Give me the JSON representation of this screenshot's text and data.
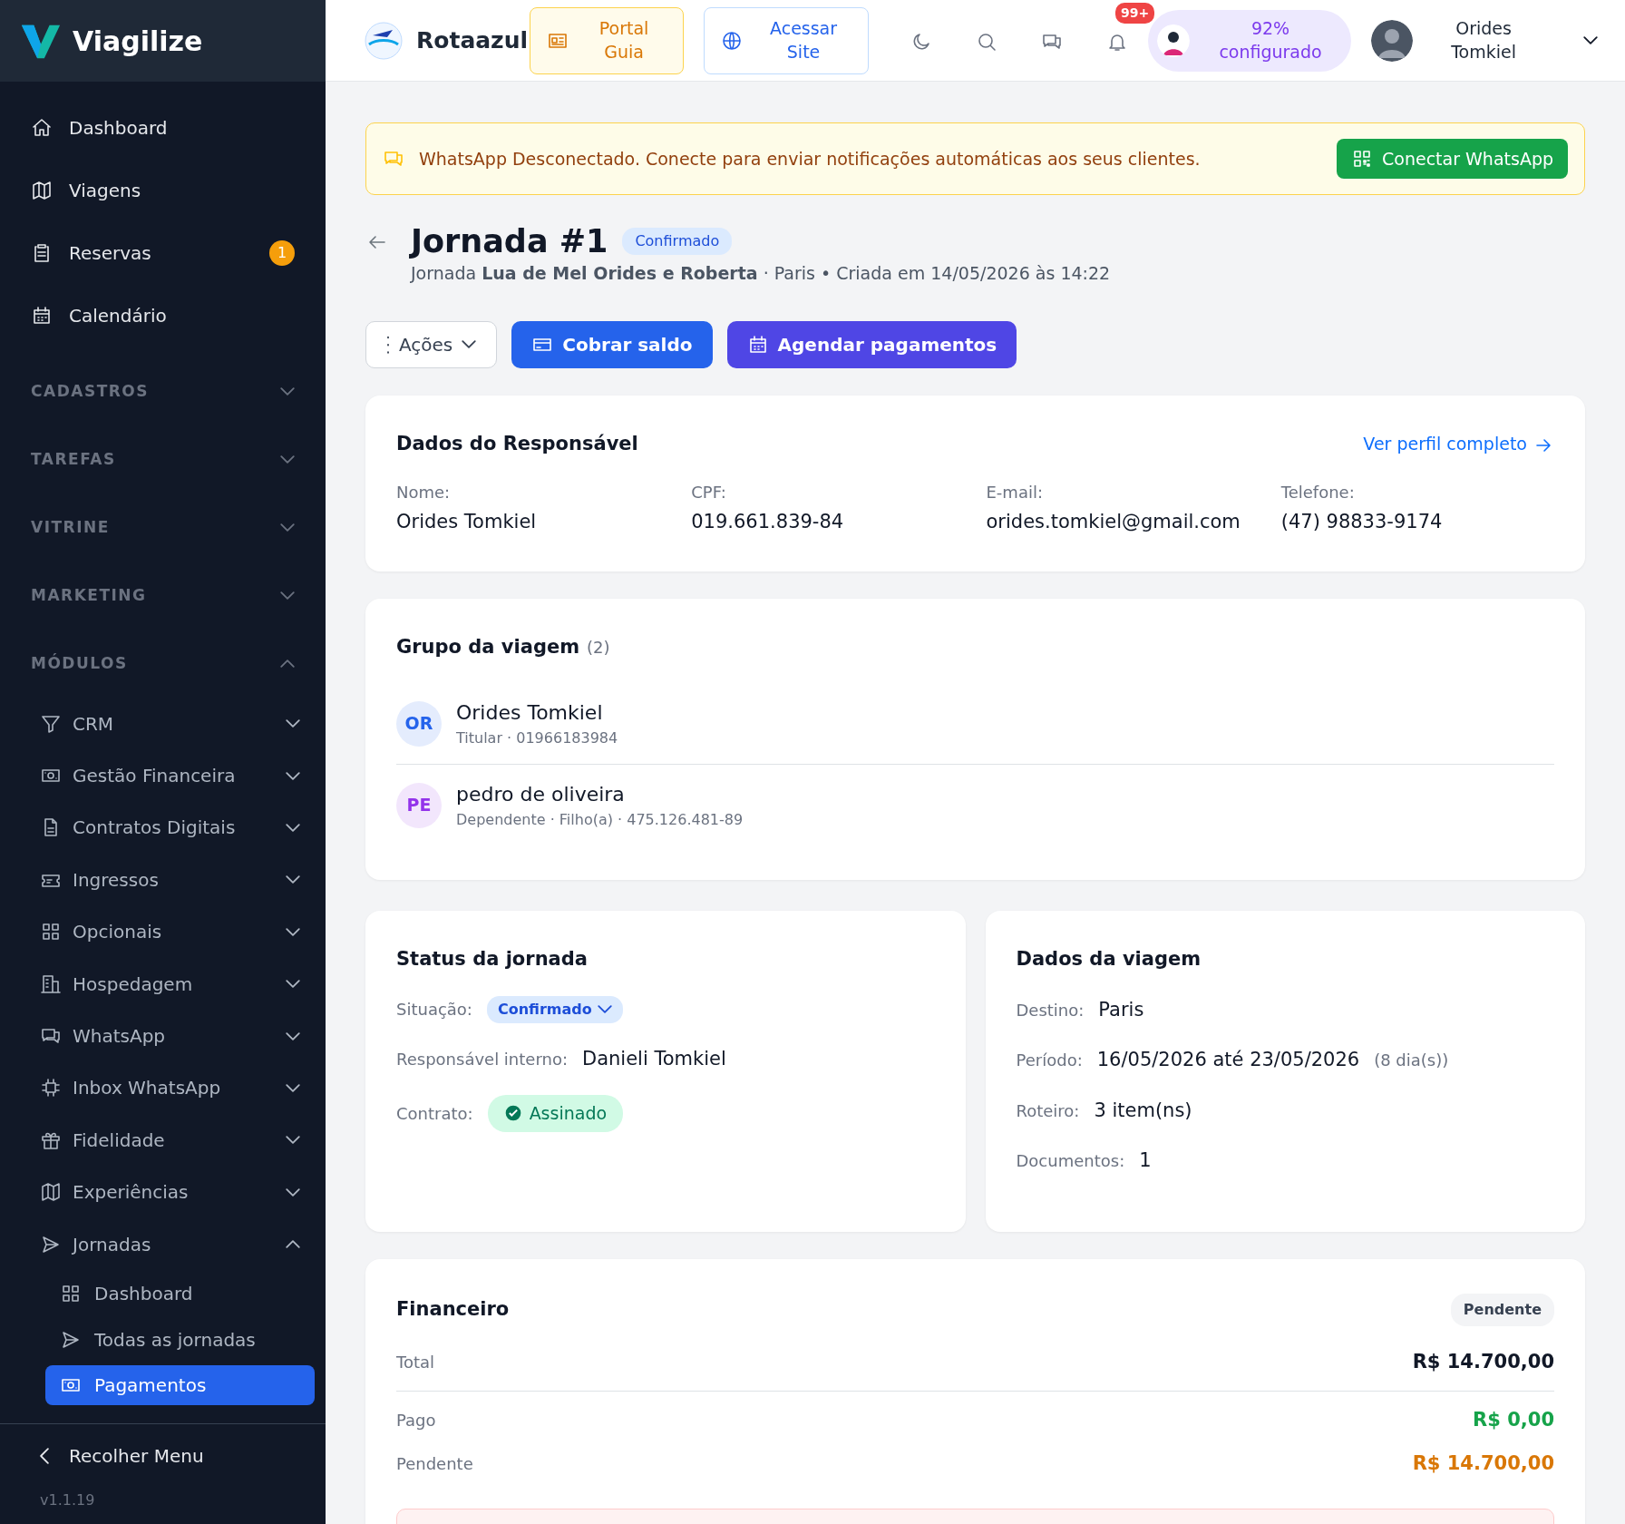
{
  "brand": {
    "name": "Viagilize"
  },
  "sidebar": {
    "items": [
      {
        "label": "Dashboard",
        "selected": false
      },
      {
        "label": "Viagens",
        "selected": false
      },
      {
        "label": "Reservas",
        "badge": "1",
        "selected": false
      },
      {
        "label": "Calendário",
        "selected": false
      }
    ],
    "sections": [
      {
        "label": "CADASTROS",
        "expanded": false
      },
      {
        "label": "TAREFAS",
        "expanded": false
      },
      {
        "label": "VITRINE",
        "expanded": false
      },
      {
        "label": "MARKETING",
        "expanded": false
      },
      {
        "label": "MÓDULOS",
        "expanded": true,
        "children": [
          {
            "label": "CRM",
            "expanded": false
          },
          {
            "label": "Gestão Financeira",
            "expanded": false
          },
          {
            "label": "Contratos Digitais",
            "expanded": false
          },
          {
            "label": "Ingressos",
            "expanded": false
          },
          {
            "label": "Opcionais",
            "expanded": false
          },
          {
            "label": "Hospedagem",
            "expanded": false
          },
          {
            "label": "WhatsApp",
            "expanded": false
          },
          {
            "label": "Inbox WhatsApp",
            "expanded": false
          },
          {
            "label": "Fidelidade",
            "expanded": false
          },
          {
            "label": "Experiências",
            "expanded": false
          },
          {
            "label": "Jornadas",
            "expanded": true,
            "children": [
              {
                "label": "Dashboard",
                "selected": false
              },
              {
                "label": "Todas as jornadas",
                "selected": false
              },
              {
                "label": "Pagamentos",
                "selected": true
              }
            ]
          }
        ]
      }
    ],
    "collapse": "Recolher Menu",
    "version": "v1.1.19"
  },
  "header": {
    "company": "Rotaazul",
    "portal_button": "Portal Guia",
    "site_button": "Acessar Site",
    "notifications_badge": "99+",
    "setup_progress": "92% configurado",
    "user_name": "Orides Tomkiel"
  },
  "alert": {
    "message": "WhatsApp Desconectado. Conecte para enviar notificações automáticas aos seus clientes.",
    "button": "Conectar WhatsApp"
  },
  "page": {
    "title": "Jornada #1",
    "status_badge": "Confirmado",
    "subtitle": "Jornada **Lua de Mel Orides e Roberta** · Paris • Criada em 14/05/2026 às 14:22"
  },
  "actions": {
    "menu": "Ações",
    "buttons": [
      "Cobrar saldo",
      "Agendar pagamentos"
    ]
  },
  "responsible": {
    "title": "Dados do Responsável",
    "link": "Ver perfil completo",
    "fields": [
      {
        "label": "Nome:",
        "value": "Orides Tomkiel"
      },
      {
        "label": "CPF:",
        "value": "019.661.839-84"
      },
      {
        "label": "E-mail:",
        "value": "orides.tomkiel@gmail.com"
      },
      {
        "label": "Telefone:",
        "value": "(47) 98833-9174"
      }
    ]
  },
  "group": {
    "title": "Grupo da viagem",
    "count": "(2)",
    "members": [
      {
        "initials": "OR",
        "name": "Orides Tomkiel",
        "details": "Titular · 01966183984",
        "color": "#2563eb"
      },
      {
        "initials": "PE",
        "name": "pedro de oliveira",
        "details": "Dependente · Filho(a) · 475.126.481-89",
        "color": "#9333ea"
      }
    ]
  },
  "status": {
    "title": "Status da jornada",
    "fields": [
      {
        "label": "Situação:",
        "value": "Confirmado",
        "kind": "dropdown"
      },
      {
        "label": "Responsável interno:",
        "value": "Danieli Tomkiel",
        "kind": "text"
      },
      {
        "label": "Contrato:",
        "value": "Assinado",
        "kind": "signed"
      }
    ]
  },
  "trip": {
    "title": "Dados da viagem",
    "fields": [
      {
        "label": "Destino:",
        "value": "Paris"
      },
      {
        "label": "Período:",
        "value": "16/05/2026 até 23/05/2026",
        "note": "(8 dia(s))"
      },
      {
        "label": "Roteiro:",
        "value": "3 item(ns)"
      },
      {
        "label": "Documentos:",
        "value": "1"
      }
    ]
  },
  "finance": {
    "title": "Financeiro",
    "badge": "Pendente",
    "rows": [
      {
        "label": "Total",
        "value": "R$ 14.700,00",
        "kind": "total"
      },
      {
        "label": "Pago",
        "value": "R$ 0,00",
        "kind": "paid"
      },
      {
        "label": "Pendente",
        "value": "R$ 14.700,00",
        "kind": "pending"
      }
    ]
  }
}
